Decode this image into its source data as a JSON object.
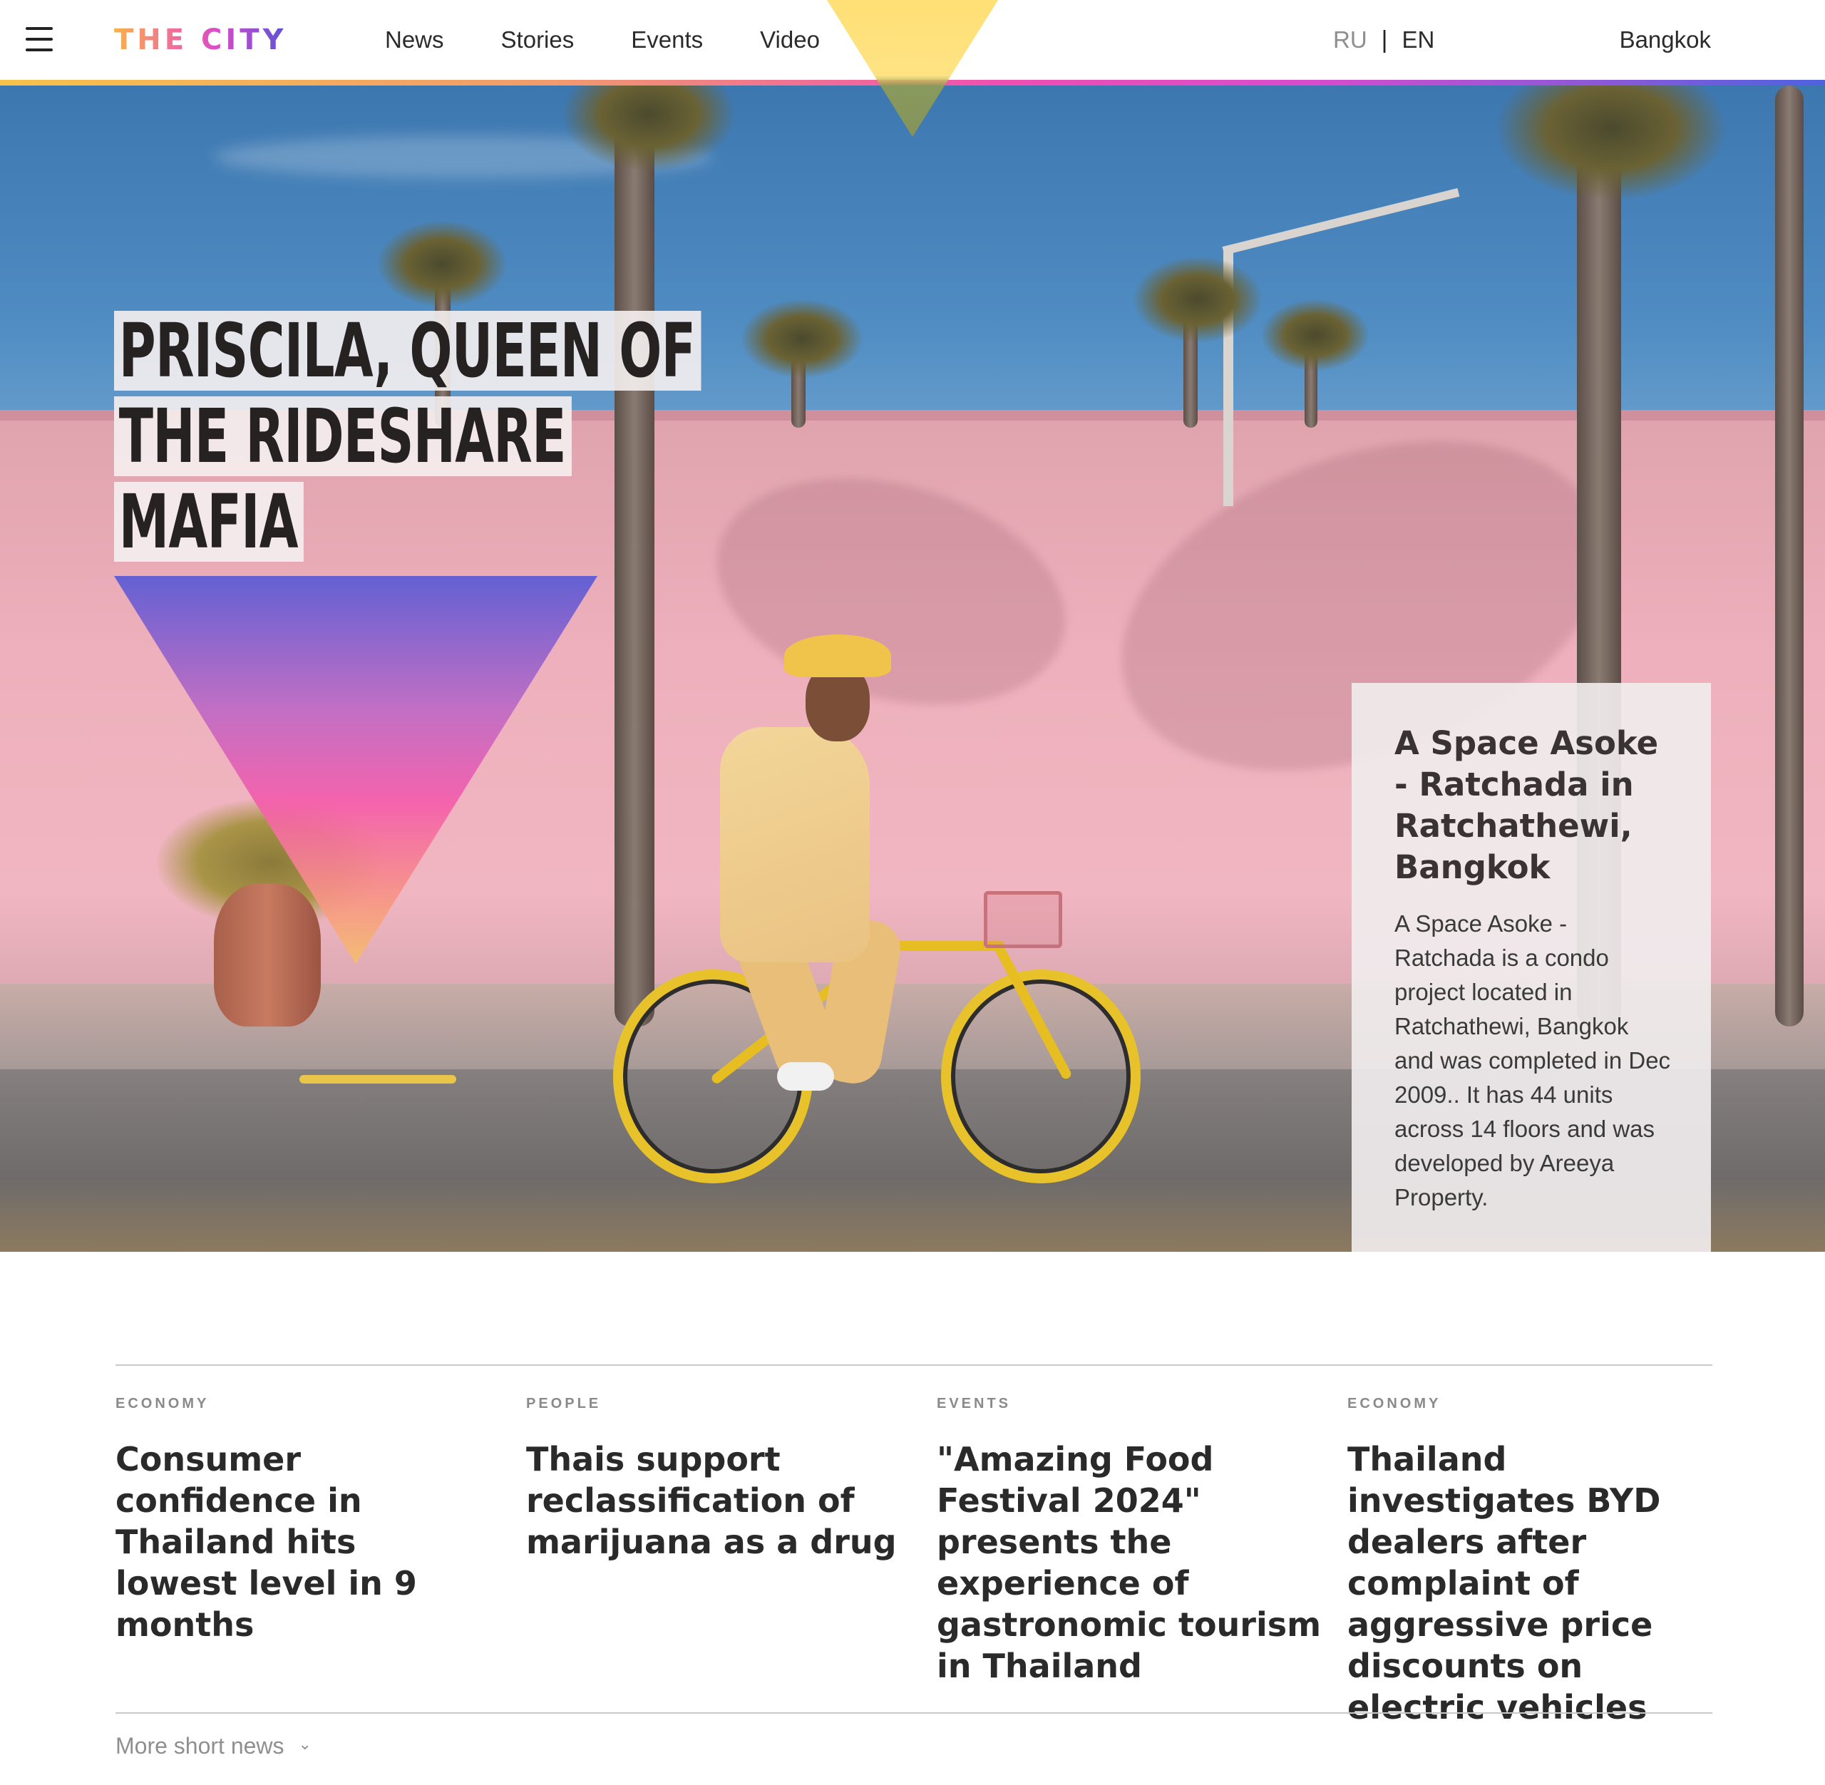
{
  "header": {
    "logo": "THE CITY",
    "nav": [
      "News",
      "Stories",
      "Events",
      "Video"
    ],
    "lang_ru": "RU",
    "lang_sep": "|",
    "lang_en": "EN",
    "city": "Bangkok"
  },
  "hero": {
    "headline_lines": [
      "PRISCILA, QUEEN OF",
      "THE RIDESHARE",
      "MAFIA"
    ]
  },
  "side_card": {
    "title": "A Space Asoke - Ratchada in Ratchathewi, Bangkok",
    "text": "A Space Asoke - Ratchada is a condo project located in Ratchathewi, Bangkok and was completed in Dec 2009.. It has 44 units across 14 floors and was developed by Areeya Property."
  },
  "news": [
    {
      "tag": "ECONOMY",
      "title": "Consumer confidence in Thailand hits lowest level in 9 months"
    },
    {
      "tag": "PEOPLE",
      "title": "Thais support reclassification of marijuana as a drug"
    },
    {
      "tag": "EVENTS",
      "title": "\"Amazing Food Festival 2024\" presents the experience of gastronomic tourism in Thailand"
    },
    {
      "tag": "ECONOMY",
      "title": "Thailand investigates BYD dealers after complaint of aggressive price discounts on electric vehicles"
    }
  ],
  "more_news": {
    "label": "More short news",
    "icon": "chevron-down-icon"
  },
  "colors": {
    "accent_gradient": [
      "#f7c24a",
      "#ef4fb2",
      "#4f62e0"
    ],
    "triangle_yellow": "#ffde6e",
    "text_dark": "#2a2a2a",
    "text_muted": "#8a8a8a"
  }
}
